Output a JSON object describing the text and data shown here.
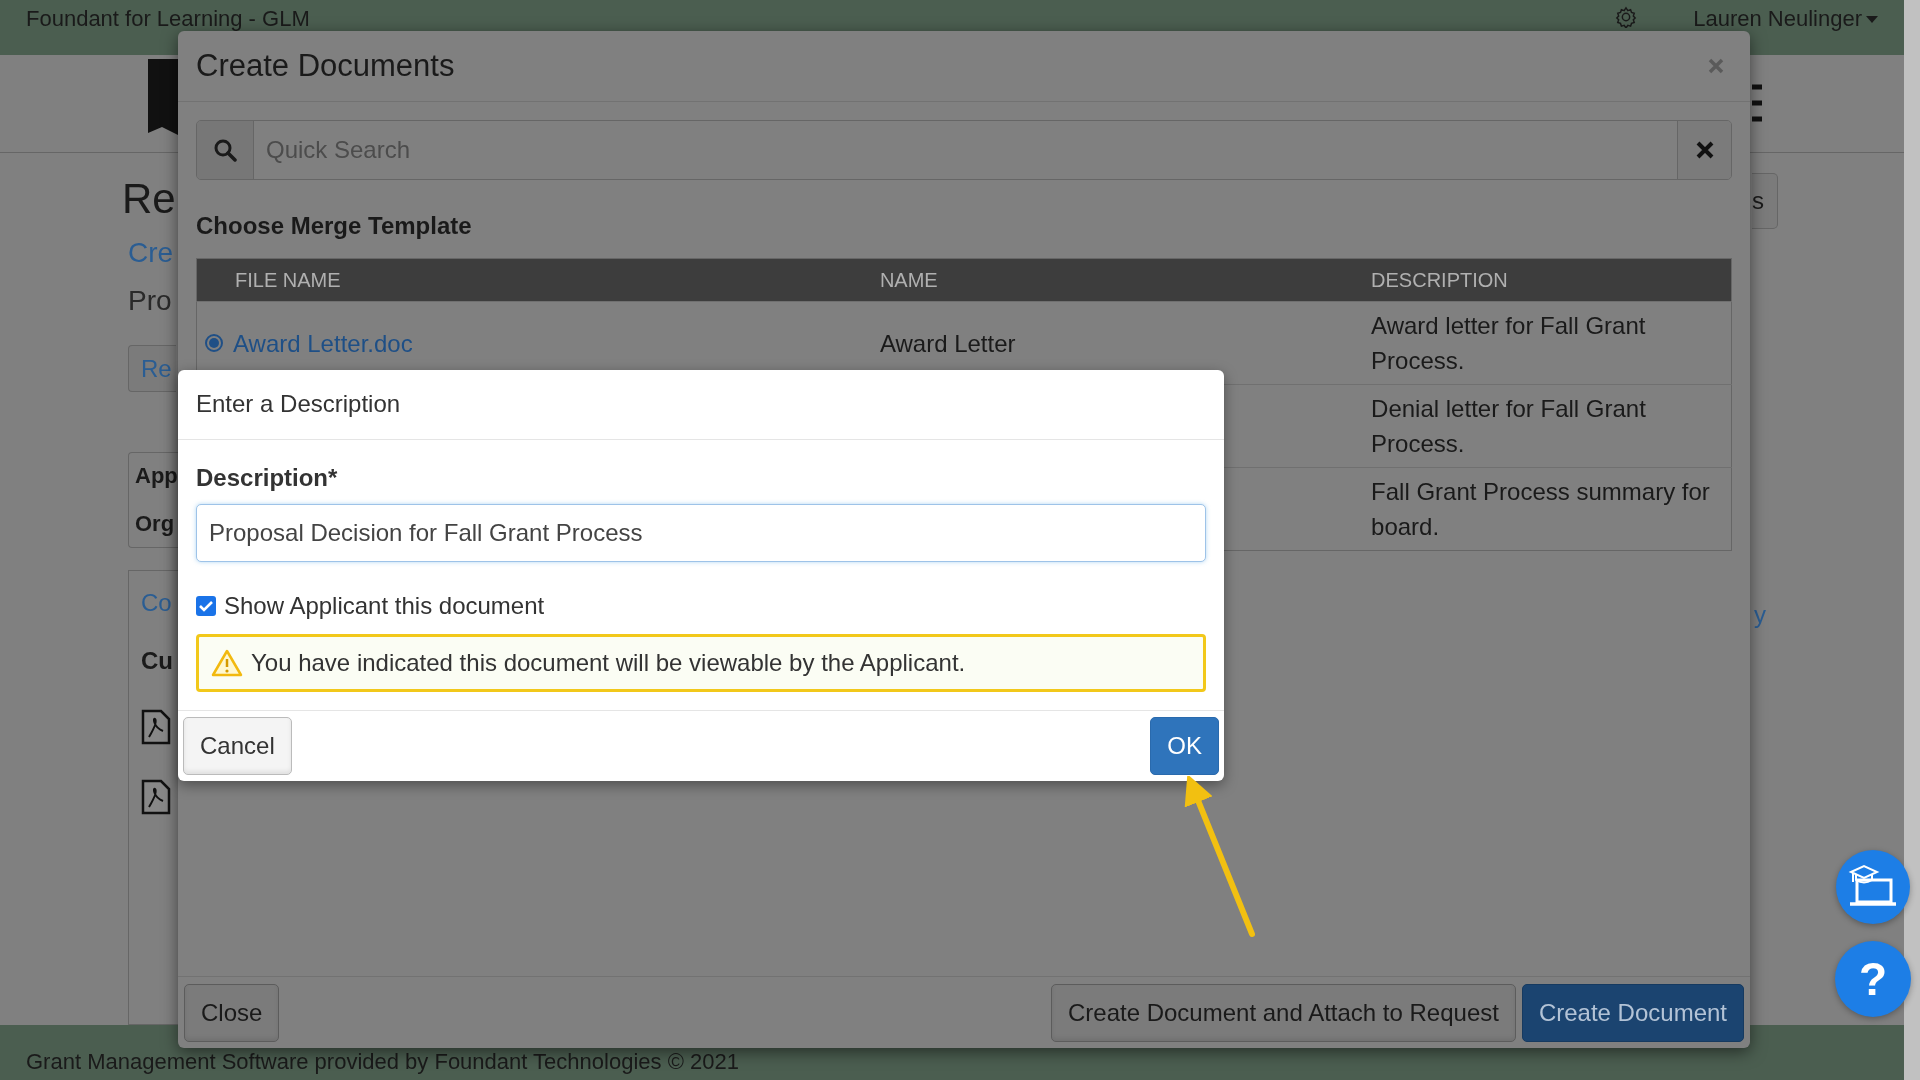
{
  "app_header": {
    "title": "Foundant for Learning - GLM",
    "user_menu": "Lauren Neulinger"
  },
  "background_page": {
    "heading": "Re",
    "link": "Cre",
    "subtitle": "Pro",
    "button": "Re",
    "info": [
      "App",
      "Org"
    ],
    "tab": "Co",
    "section": "Cu",
    "right_button": "s",
    "right_link": "y"
  },
  "footer": "Grant Management Software provided by Foundant Technologies © 2021",
  "create_documents": {
    "title": "Create Documents",
    "search": {
      "placeholder": "Quick Search"
    },
    "section_title": "Choose Merge Template",
    "table": {
      "columns": [
        "FILE NAME",
        "NAME",
        "DESCRIPTION"
      ],
      "rows": [
        {
          "file_name": "Award Letter.doc",
          "name": "Award Letter",
          "description": "Award letter for Fall Grant Process.",
          "selected": true
        },
        {
          "description": "Denial letter for Fall Grant Process."
        },
        {
          "description": "Fall Grant Process summary for board."
        }
      ]
    },
    "buttons": [
      {
        "label": "Close",
        "kind": "default"
      },
      {
        "label": "Create Document and Attach to Request",
        "kind": "default"
      },
      {
        "label": "Create Document",
        "kind": "primary"
      }
    ]
  },
  "description_dialog": {
    "title": "Enter a Description",
    "field": {
      "label": "Description*",
      "value": "Proposal Decision for Fall Grant Process"
    },
    "show_applicant": {
      "label": "Show Applicant this document",
      "checked": true
    },
    "warning": "You have indicated this document will be viewable by the Applicant.",
    "buttons": [
      {
        "label": "Cancel",
        "kind": "default"
      },
      {
        "label": "OK",
        "kind": "primary"
      }
    ]
  },
  "help_button": "?"
}
